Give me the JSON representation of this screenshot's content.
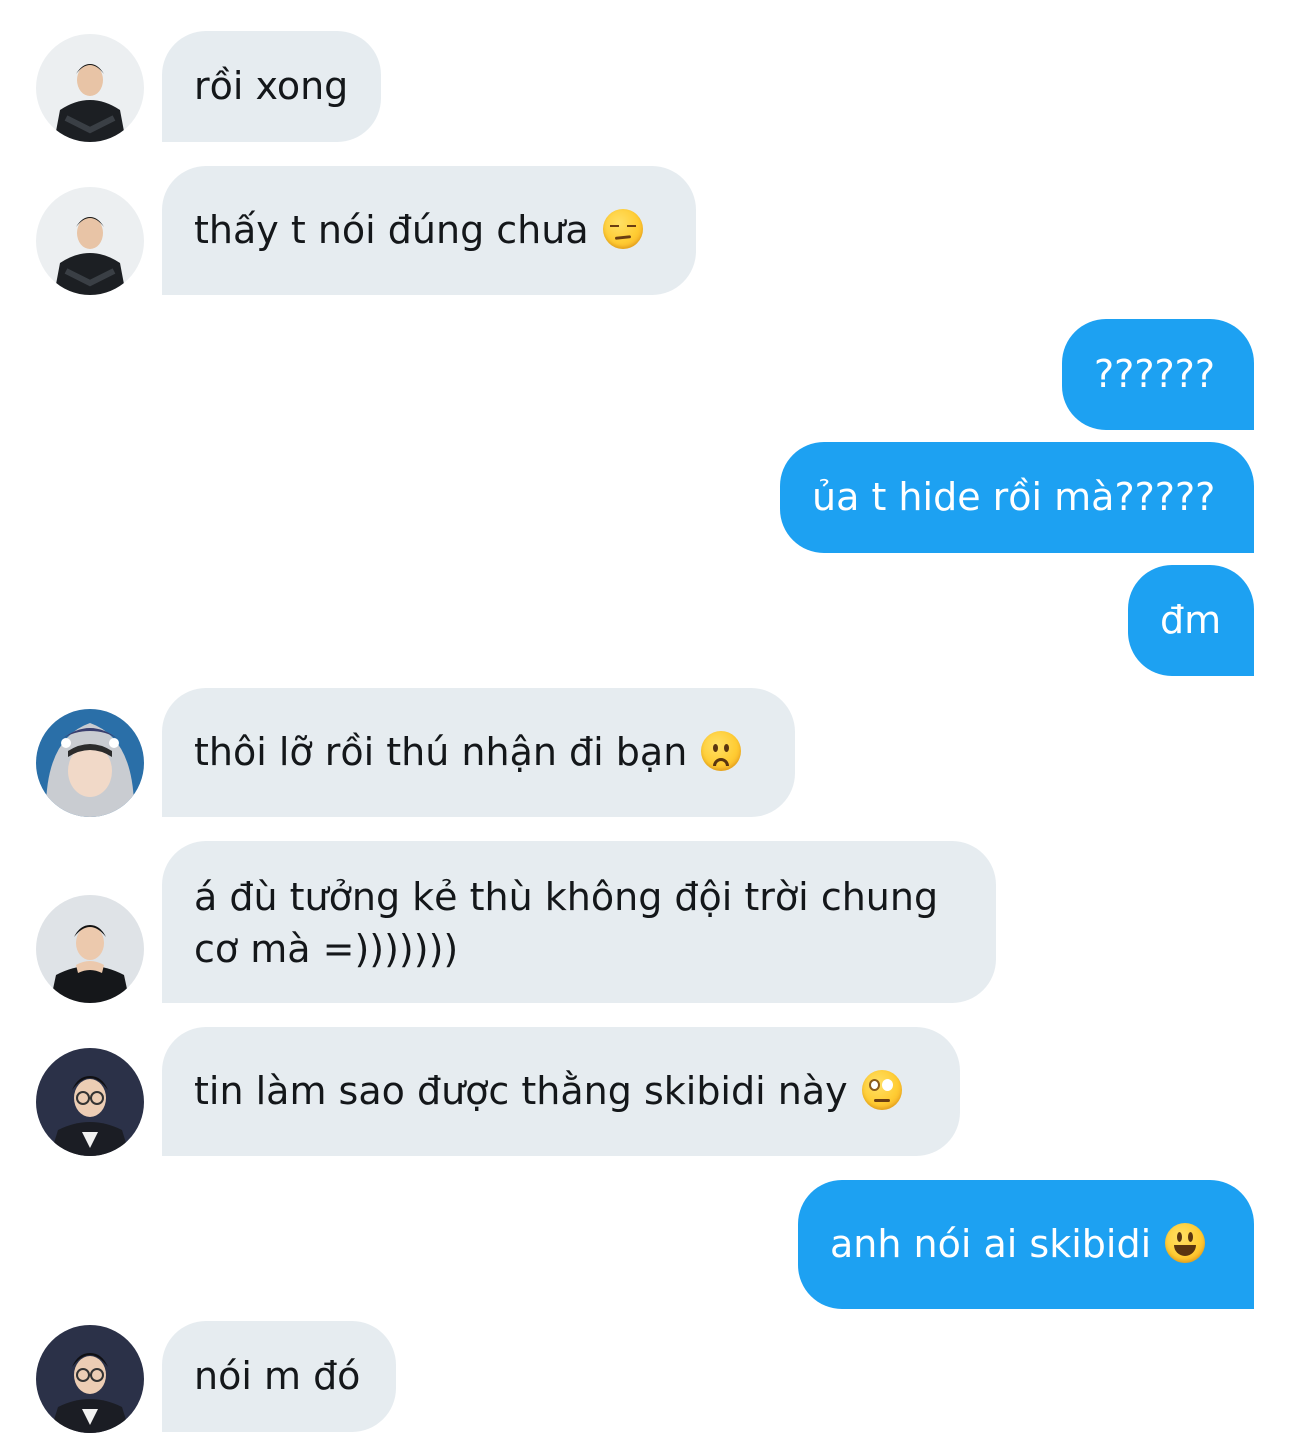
{
  "messages": [
    {
      "side": "in",
      "text": "rồi xong",
      "emoji": null,
      "avatar": "avatar-jacket"
    },
    {
      "side": "in",
      "text": "thấy t nói đúng chưa",
      "emoji": "unamused-face-emoji",
      "avatar": "avatar-jacket"
    },
    {
      "side": "out",
      "text": "??????",
      "emoji": null
    },
    {
      "side": "out",
      "text": "ủa t hide rồi mà?????",
      "emoji": null
    },
    {
      "side": "out",
      "text": "đm",
      "emoji": null
    },
    {
      "side": "in",
      "text": "thôi lỡ rồi thú nhận đi bạn",
      "emoji": "slightly-frowning-face-emoji",
      "avatar": "avatar-hood"
    },
    {
      "side": "in",
      "text_lines": [
        "á đù tưởng kẻ thù không đội trời chung",
        "cơ mà =)))))))"
      ],
      "emoji": null,
      "avatar": "avatar-hands"
    },
    {
      "side": "in",
      "text": "tin làm sao được thằng skibidi này",
      "emoji": "face-with-rolling-eyes-emoji",
      "avatar": "avatar-glasses"
    },
    {
      "side": "out",
      "text": "anh nói ai skibidi",
      "emoji": "smiling-face-emoji"
    },
    {
      "side": "in",
      "text": "nói m đó",
      "emoji": null,
      "avatar": "avatar-glasses"
    }
  ],
  "colors": {
    "incoming_bubble": "#e6ecf0",
    "outgoing_bubble": "#1da1f2",
    "incoming_text": "#14171a",
    "outgoing_text": "#ffffff"
  }
}
